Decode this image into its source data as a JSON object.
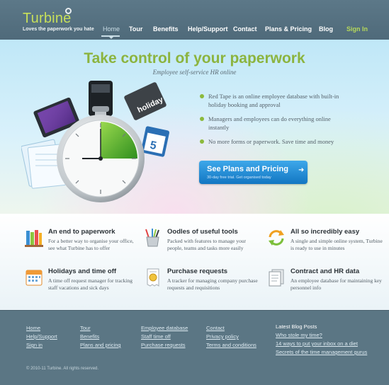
{
  "brand": {
    "name": "Turbine",
    "tagline": "Loves the paperwork you hate"
  },
  "nav": {
    "items": [
      {
        "label": "Home",
        "active": true
      },
      {
        "label": "Tour"
      },
      {
        "label": "Benefits"
      },
      {
        "label": "Help/Support"
      },
      {
        "label": "Contact"
      },
      {
        "label": "Plans & Pricing"
      },
      {
        "label": "Blog"
      }
    ],
    "signin": "Sign In"
  },
  "hero": {
    "title": "Take control of your paperwork",
    "subtitle": "Employee self-service HR online",
    "bullets": [
      "Red Tape is an online employee database with built-in holiday booking and approval",
      "Managers and employees can do everything online instantly",
      "No more forms or paperwork. Save time and money"
    ],
    "cta": {
      "label": "See Plans and Pricing",
      "sublabel": "30-day free trial. Get organised today"
    },
    "illustration": {
      "sign_text": "holiday",
      "calendar_day": "5"
    }
  },
  "features": [
    {
      "title": "An end to paperwork",
      "desc": "For a better way to organise your office, see what Turbine has to offer",
      "icon": "books-icon"
    },
    {
      "title": "Oodles of useful tools",
      "desc": "Packed with features to manage your people, teams and tasks more easily",
      "icon": "tools-cup-icon"
    },
    {
      "title": "All so incredibly easy",
      "desc": "A single and simple online system, Turbine is ready to use in minutes",
      "icon": "refresh-arrows-icon"
    },
    {
      "title": "Holidays and time off",
      "desc": "A time off request manager for tracking staff vacations and sick days",
      "icon": "calendar-icon"
    },
    {
      "title": "Purchase requests",
      "desc": "A tracker for managing company purchase requests and requisitions",
      "icon": "receipt-icon"
    },
    {
      "title": "Contract and HR data",
      "desc": "An employee database for maintaining key personnel info",
      "icon": "document-icon"
    }
  ],
  "footer": {
    "columns": [
      [
        "Home",
        "Help/Support",
        "Sign in"
      ],
      [
        "Tour",
        "Benefits",
        "Plans and pricing"
      ],
      [
        "Employee database",
        "Staff time off",
        "Purchase requests"
      ],
      [
        "Contact",
        "Privacy policy",
        "Terms and conditions"
      ]
    ],
    "blog": {
      "heading": "Latest Blog Posts",
      "posts": [
        "Who stole my time?",
        "14 ways to put your inbox on a diet",
        "Secrets of the time management gurus"
      ]
    },
    "copyright": "© 2010-11 Turbine. All rights reserved."
  },
  "colors": {
    "accent_green": "#8cb43f",
    "cta_blue": "#1f8ad6",
    "header_bg": "#55707f"
  }
}
